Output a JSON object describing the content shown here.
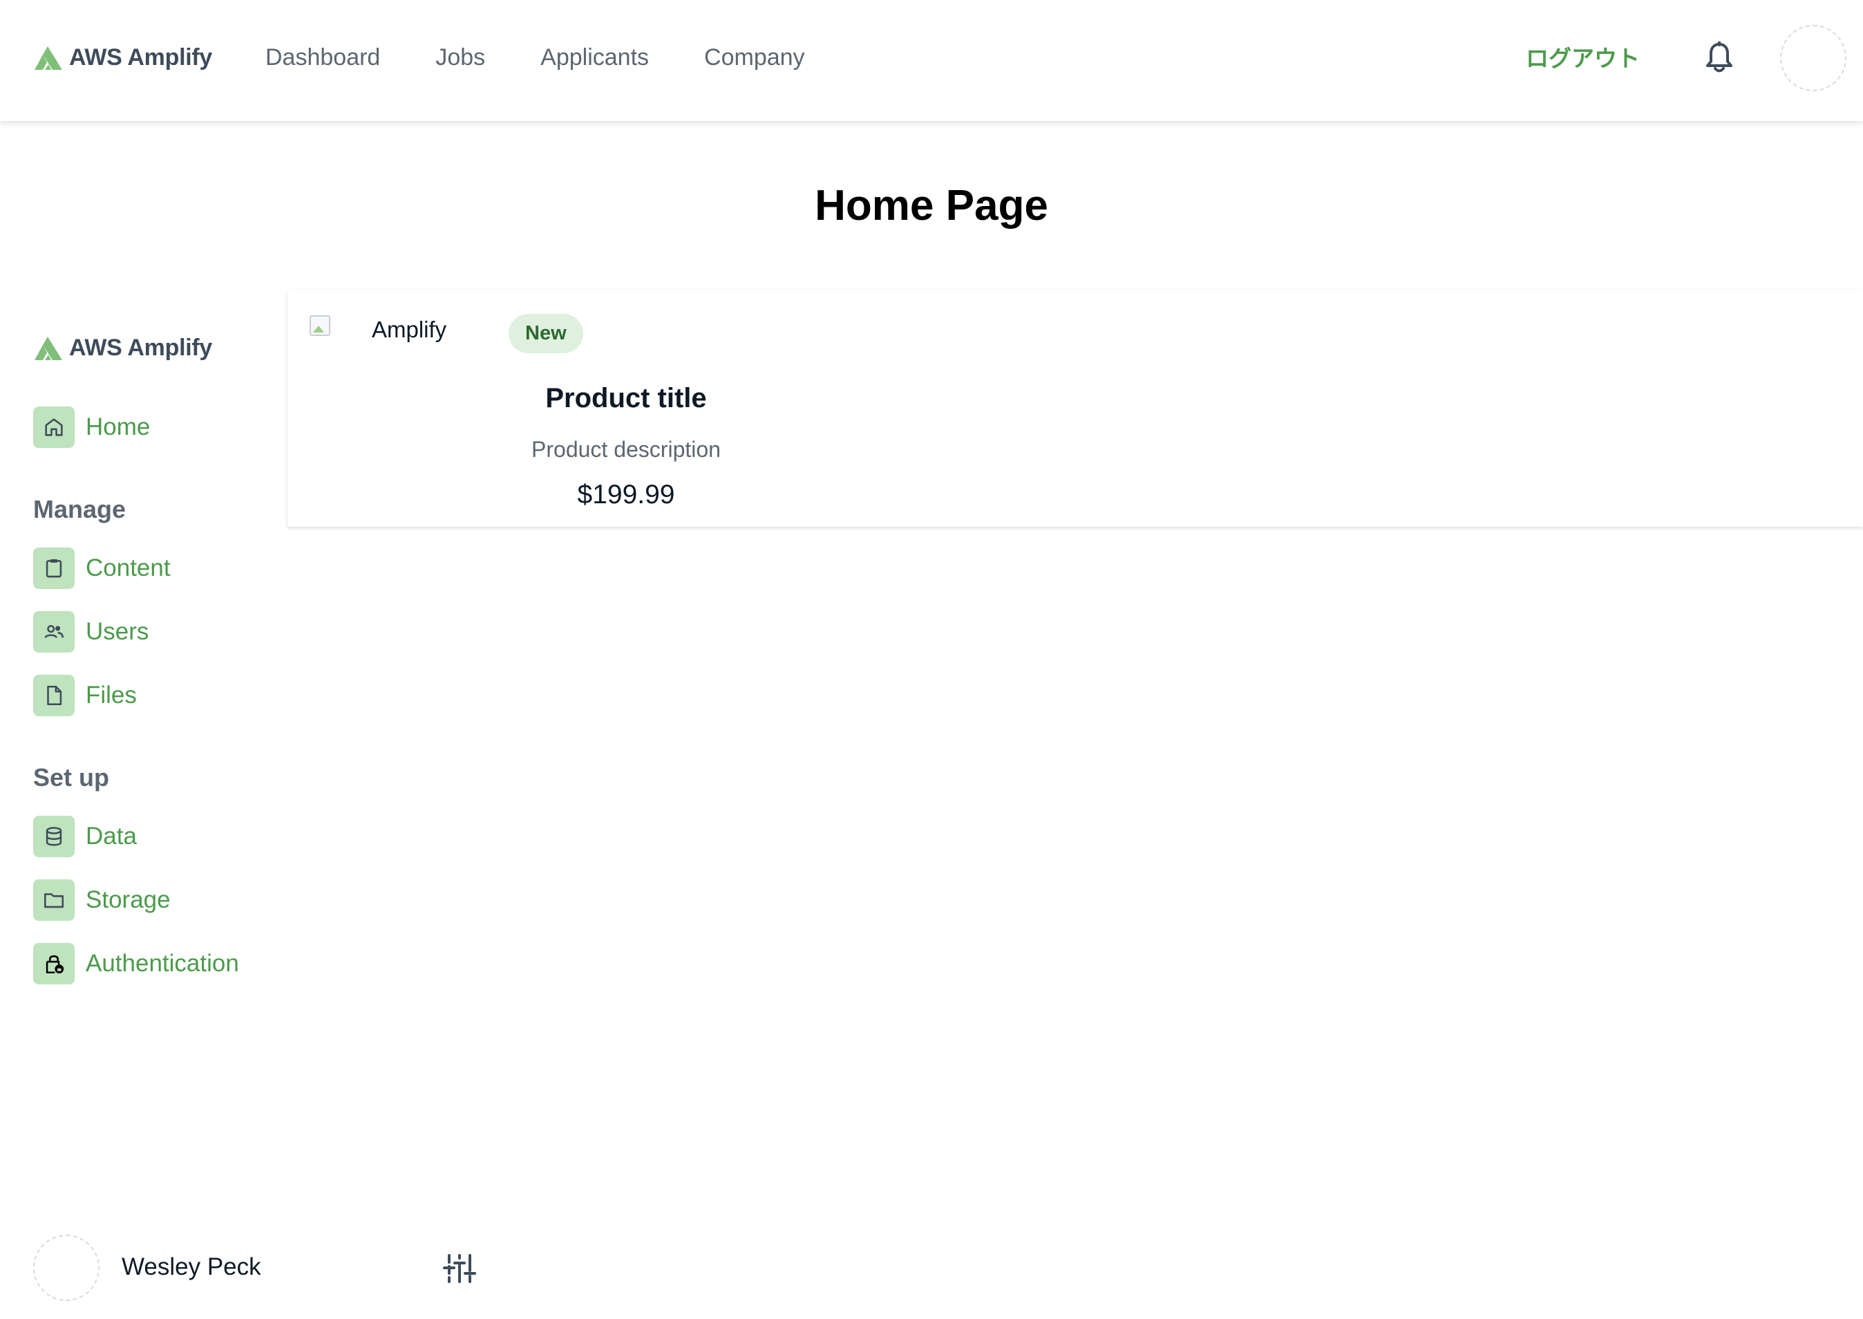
{
  "brand": {
    "name": "AWS Amplify"
  },
  "topnav": {
    "links": [
      "Dashboard",
      "Jobs",
      "Applicants",
      "Company"
    ],
    "logout_label": "ログアウト"
  },
  "page": {
    "title": "Home Page"
  },
  "sidebar": {
    "brand_name": "AWS Amplify",
    "home": {
      "label": "Home",
      "icon": "home-icon"
    },
    "sections": [
      {
        "heading": "Manage",
        "items": [
          {
            "label": "Content",
            "icon": "clipboard-icon"
          },
          {
            "label": "Users",
            "icon": "users-icon"
          },
          {
            "label": "Files",
            "icon": "file-icon"
          }
        ]
      },
      {
        "heading": "Set up",
        "items": [
          {
            "label": "Data",
            "icon": "database-icon"
          },
          {
            "label": "Storage",
            "icon": "folder-icon"
          },
          {
            "label": "Authentication",
            "icon": "lock-icon"
          }
        ]
      }
    ]
  },
  "card": {
    "image_alt": "Amplify",
    "badge": "New",
    "title": "Product title",
    "description": "Product description",
    "price": "$199.99"
  },
  "user": {
    "name": "Wesley Peck"
  },
  "colors": {
    "accent": "#4b9b4a",
    "icon_bg": "#bfe3bd",
    "badge_bg": "#dff1de",
    "muted_text": "#5c6670"
  }
}
